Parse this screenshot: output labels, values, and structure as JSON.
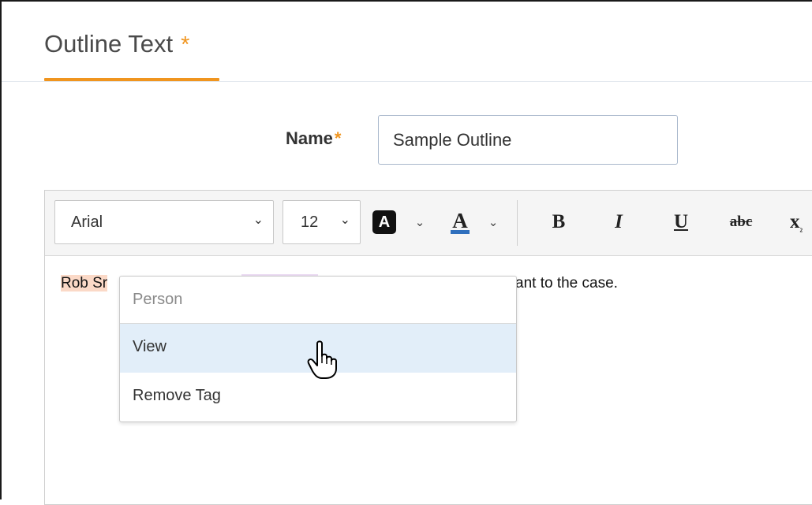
{
  "header": {
    "title": "Outline Text",
    "required_mark": "*"
  },
  "form": {
    "name_label": "Name",
    "required_mark": "*",
    "name_value": "Sample Outline"
  },
  "toolbar": {
    "font_family": "Arial",
    "font_size": "12",
    "highlight_letter": "A",
    "font_color_letter": "A",
    "bold_label": "B",
    "italic_label": "I",
    "underline_label": "U",
    "strike_label": "abc",
    "subscript_label": "x"
  },
  "editor": {
    "text_start": "Rob Sr",
    "text_end": "ant to the case."
  },
  "context_menu": {
    "header": "Person",
    "items": [
      {
        "label": "View"
      },
      {
        "label": "Remove Tag"
      }
    ]
  },
  "colors": {
    "accent": "#f0951f",
    "menu_hover": "#e2eef9",
    "person_tag": "#fbd9c7",
    "other_tag": "#ecdcf3",
    "font_color_bar": "#2f6fbd"
  },
  "icons": {
    "dropdown": "chevron-down-icon",
    "cursor": "hand-pointer-icon"
  }
}
